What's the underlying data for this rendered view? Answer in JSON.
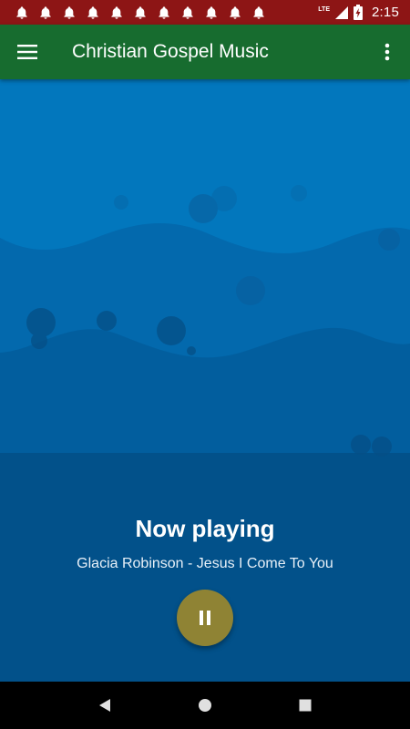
{
  "status_bar": {
    "notification_icons": [
      "bell-icon",
      "bell-icon",
      "bell-icon",
      "bell-icon",
      "bell-icon",
      "bell-icon",
      "bell-icon",
      "bell-icon",
      "bell-icon",
      "bell-icon",
      "bell-icon"
    ],
    "network_label": "LTE",
    "time": "2:15",
    "colors": {
      "background": "#8d1515"
    }
  },
  "app_bar": {
    "title": "Christian Gospel Music",
    "menu_icon": "hamburger-menu-icon",
    "overflow_icon": "more-vert-icon",
    "colors": {
      "background": "#176c2f"
    }
  },
  "player": {
    "heading": "Now playing",
    "track": "Glacia Robinson - Jesus I Come To You",
    "control_icon": "pause-icon",
    "colors": {
      "button": "#8f8334",
      "sky": "#0277bd",
      "deep": "#02518a"
    }
  },
  "nav_bar": {
    "back_icon": "back-triangle-icon",
    "home_icon": "home-circle-icon",
    "recents_icon": "recents-square-icon"
  }
}
